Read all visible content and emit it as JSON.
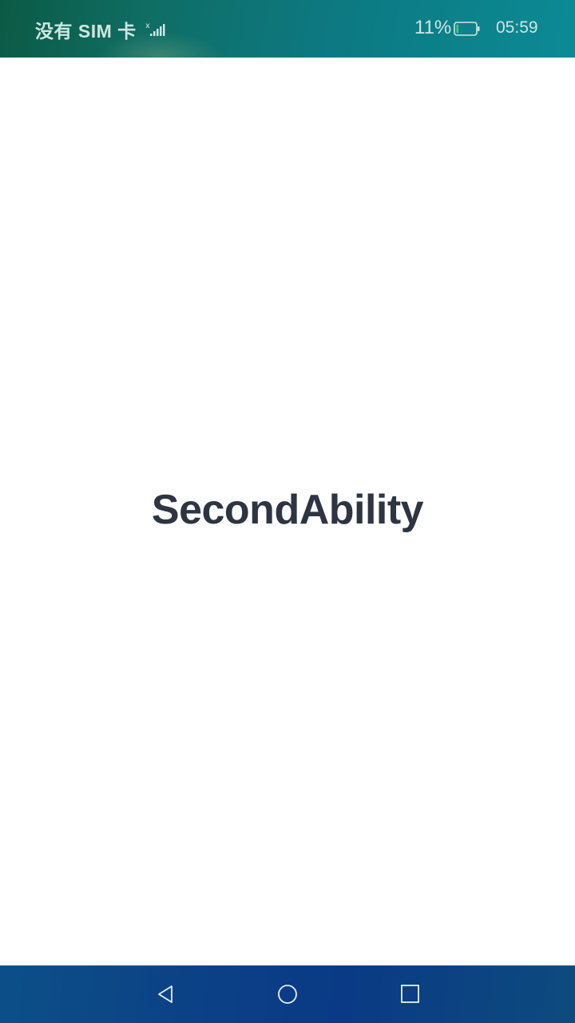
{
  "status_bar": {
    "carrier": "没有 SIM 卡",
    "battery_percent": "11%",
    "battery_level": 0.11,
    "time": "05:59",
    "icons": [
      "signal-icon",
      "battery-icon"
    ]
  },
  "main": {
    "title": "SecondAbility"
  },
  "nav_bar": {
    "buttons": [
      "back-icon",
      "home-icon",
      "recent-apps-icon"
    ]
  },
  "colors": {
    "title": "#2e3542",
    "status_bar": "#0d7880",
    "nav_bar": "#0b3f86",
    "background": "#ffffff"
  }
}
